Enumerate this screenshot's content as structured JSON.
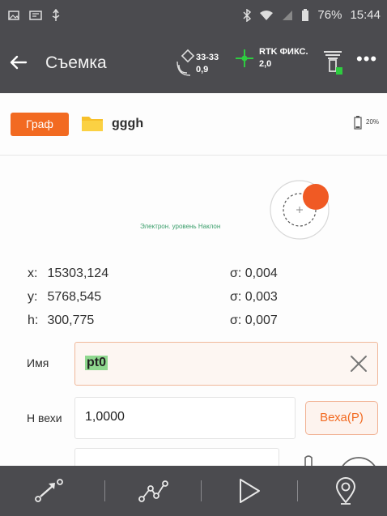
{
  "status_bar": {
    "battery": "76%",
    "time": "15:44",
    "icons": [
      "image-icon",
      "sim-icon",
      "usb-icon",
      "bluetooth-icon",
      "wifi-icon",
      "signal-icon",
      "battery-icon"
    ]
  },
  "app_bar": {
    "title": "Съемка",
    "satellites": {
      "count": "33-33",
      "value": "0,9"
    },
    "fix": {
      "status": "RTK ФИКС.",
      "value": "2,0"
    }
  },
  "toolbar": {
    "graph_button": "Граф",
    "project_name": "gggh",
    "device_battery": "20%"
  },
  "level_indicator": {
    "text": "Электрон. уровень Наклон"
  },
  "coordinates": [
    {
      "label": "x:",
      "value": "15303,124",
      "sigma": "σ: 0,004"
    },
    {
      "label": "y:",
      "value": "5768,545",
      "sigma": "σ: 0,003"
    },
    {
      "label": "h:",
      "value": "300,775",
      "sigma": "σ: 0,007"
    }
  ],
  "form": {
    "name_label": "Имя",
    "name_value": "pt0",
    "height_label": "Н вехи",
    "height_value": "1,0000",
    "pole_button": "Веха(P)"
  },
  "colors": {
    "accent": "#f26a21",
    "bar": "#4b4b4f",
    "fix_green": "#2ecc40"
  }
}
